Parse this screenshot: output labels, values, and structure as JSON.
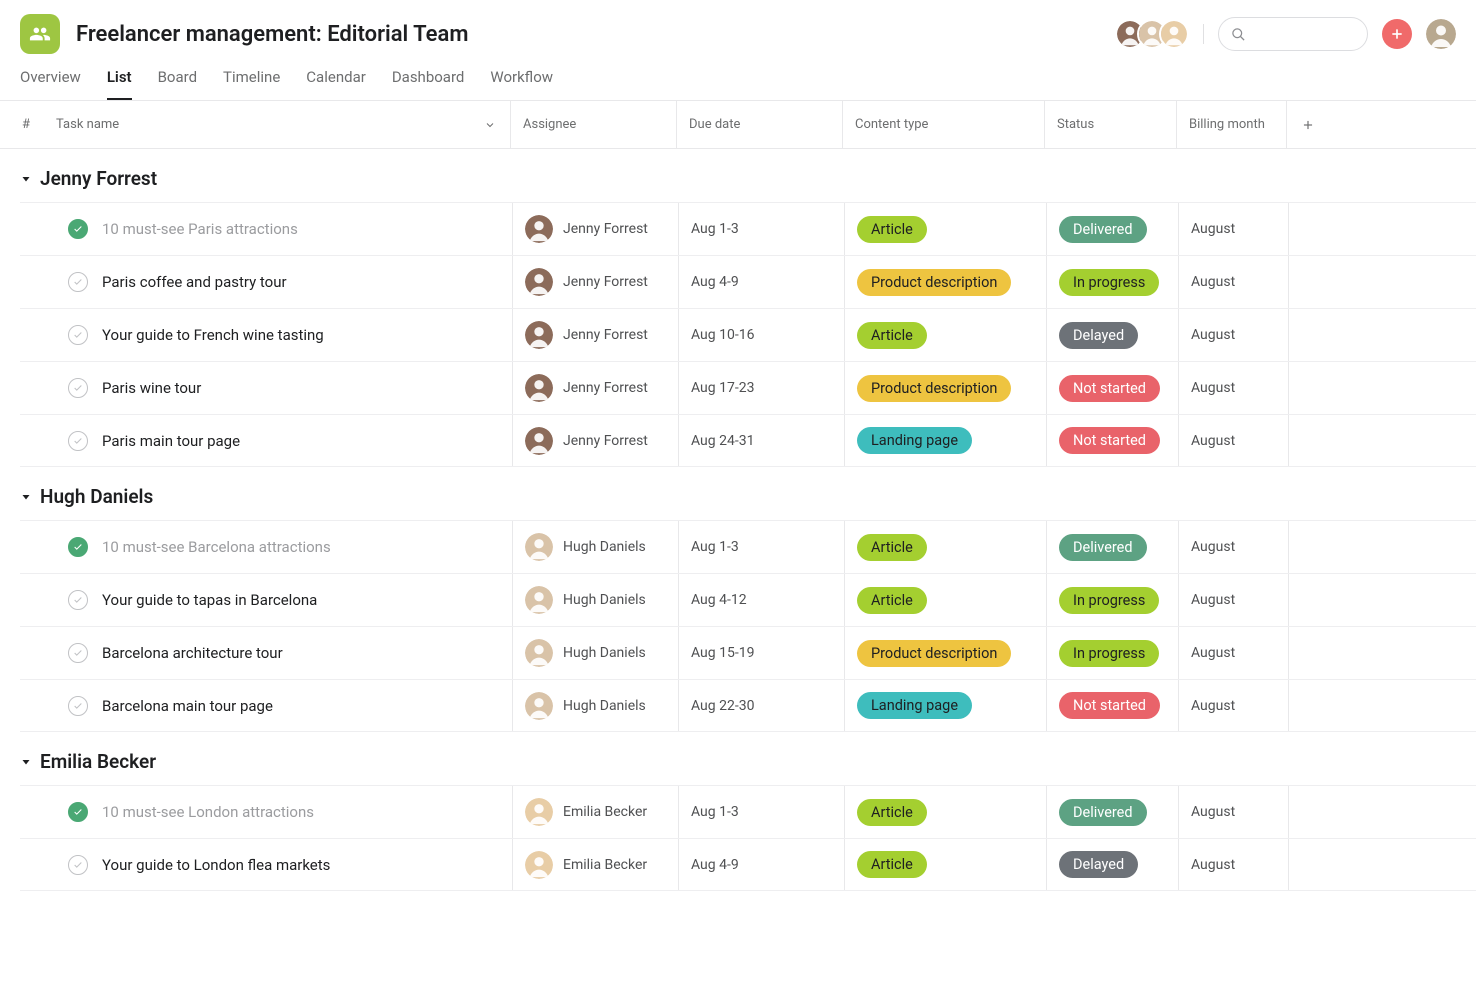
{
  "project": {
    "title": "Freelancer management: Editorial Team"
  },
  "tabs": [
    "Overview",
    "List",
    "Board",
    "Timeline",
    "Calendar",
    "Dashboard",
    "Workflow"
  ],
  "active_tab": 1,
  "columns": {
    "num": "#",
    "task": "Task name",
    "assignee": "Assignee",
    "due": "Due date",
    "content": "Content type",
    "status": "Status",
    "billing": "Billing month"
  },
  "content_type_styles": {
    "Article": "pill-article",
    "Product description": "pill-product",
    "Landing page": "pill-landing"
  },
  "status_styles": {
    "Delivered": "pill-delivered",
    "In progress": "pill-inprogress",
    "Delayed": "pill-delayed",
    "Not started": "pill-notstarted"
  },
  "member_colors": [
    "#8c6b5a",
    "#d9c3a8",
    "#e8cda6"
  ],
  "user_avatar_color": "#b8a88f",
  "sections": [
    {
      "name": "Jenny Forrest",
      "avatar_color": "#8c6b5a",
      "tasks": [
        {
          "done": true,
          "name": "10 must-see Paris attractions",
          "assignee": "Jenny Forrest",
          "due": "Aug 1-3",
          "content": "Article",
          "status": "Delivered",
          "billing": "August"
        },
        {
          "done": false,
          "name": "Paris coffee and pastry tour",
          "assignee": "Jenny Forrest",
          "due": "Aug 4-9",
          "content": "Product description",
          "status": "In progress",
          "billing": "August"
        },
        {
          "done": false,
          "name": "Your guide to French wine tasting",
          "assignee": "Jenny Forrest",
          "due": "Aug 10-16",
          "content": "Article",
          "status": "Delayed",
          "billing": "August"
        },
        {
          "done": false,
          "name": "Paris wine tour",
          "assignee": "Jenny Forrest",
          "due": "Aug 17-23",
          "content": "Product description",
          "status": "Not started",
          "billing": "August"
        },
        {
          "done": false,
          "name": "Paris main tour page",
          "assignee": "Jenny Forrest",
          "due": "Aug 24-31",
          "content": "Landing page",
          "status": "Not started",
          "billing": "August"
        }
      ]
    },
    {
      "name": "Hugh Daniels",
      "avatar_color": "#d9c3a8",
      "tasks": [
        {
          "done": true,
          "name": "10 must-see Barcelona attractions",
          "assignee": "Hugh Daniels",
          "due": "Aug 1-3",
          "content": "Article",
          "status": "Delivered",
          "billing": "August"
        },
        {
          "done": false,
          "name": "Your guide to tapas in Barcelona",
          "assignee": "Hugh Daniels",
          "due": "Aug 4-12",
          "content": "Article",
          "status": "In progress",
          "billing": "August"
        },
        {
          "done": false,
          "name": "Barcelona architecture tour",
          "assignee": "Hugh Daniels",
          "due": "Aug 15-19",
          "content": "Product description",
          "status": "In progress",
          "billing": "August"
        },
        {
          "done": false,
          "name": "Barcelona main tour page",
          "assignee": "Hugh Daniels",
          "due": "Aug 22-30",
          "content": "Landing page",
          "status": "Not started",
          "billing": "August"
        }
      ]
    },
    {
      "name": "Emilia Becker",
      "avatar_color": "#e8cda6",
      "tasks": [
        {
          "done": true,
          "name": "10 must-see London attractions",
          "assignee": "Emilia Becker",
          "due": "Aug 1-3",
          "content": "Article",
          "status": "Delivered",
          "billing": "August"
        },
        {
          "done": false,
          "name": "Your guide to London flea markets",
          "assignee": "Emilia Becker",
          "due": "Aug 4-9",
          "content": "Article",
          "status": "Delayed",
          "billing": "August"
        }
      ]
    }
  ]
}
